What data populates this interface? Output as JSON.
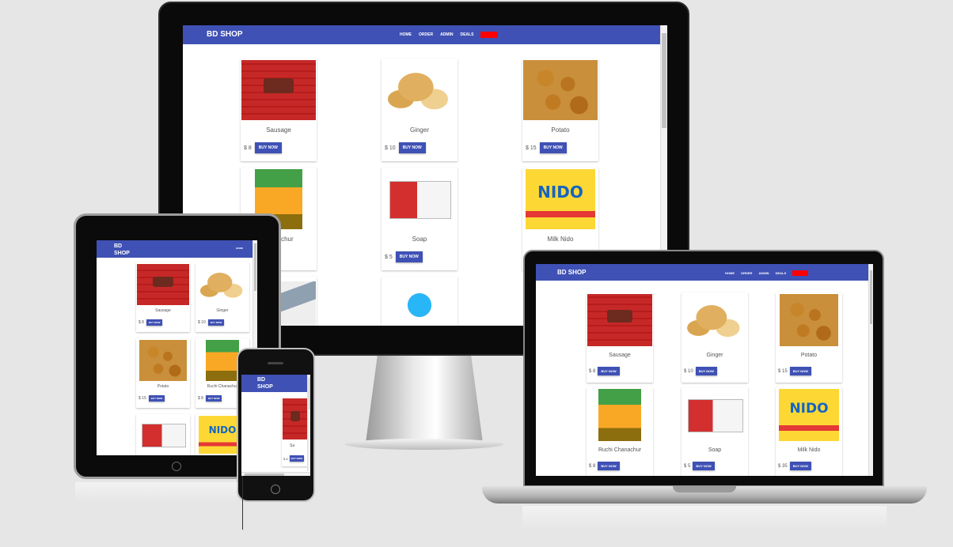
{
  "site": {
    "brand": "BD SHOP",
    "brand_line1": "BD",
    "brand_line2": "SHOP",
    "nav": [
      "HOME",
      "ORDER",
      "ADMIN",
      "DEALS"
    ]
  },
  "products": [
    {
      "name": "Sausage",
      "price": "$ 8",
      "button": "BUY NOW",
      "image": "sausage-image"
    },
    {
      "name": "Ginger",
      "price": "$ 10",
      "button": "BUY NOW",
      "image": "ginger-image"
    },
    {
      "name": "Potato",
      "price": "$ 15",
      "button": "BUY NOW",
      "image": "potato-image"
    },
    {
      "name": "Ruchi Chanachur",
      "price": "$ 8",
      "button": "BUY NOW",
      "image": "chanachur-image"
    },
    {
      "name": "Soap",
      "price": "$ 5",
      "button": "BUY NOW",
      "image": "soap-image"
    },
    {
      "name": "Milk Nido",
      "price": "$ 35",
      "button": "BUY NOW",
      "image": "nido-image"
    }
  ],
  "monitor_names": [
    "Sausage",
    "Ginger",
    "Potato",
    "chanachur",
    "Soap",
    "Milk Nido"
  ],
  "monitor_prices": [
    "$ 8",
    "$ 10",
    "$ 15",
    "",
    "$ 5",
    ""
  ],
  "phone": {
    "partial_name": "Sa",
    "partial_price": "$ 8"
  },
  "colors": {
    "nav": "#3f51b5",
    "button": "#3f51b5",
    "deals_badge": "#ff0000"
  }
}
